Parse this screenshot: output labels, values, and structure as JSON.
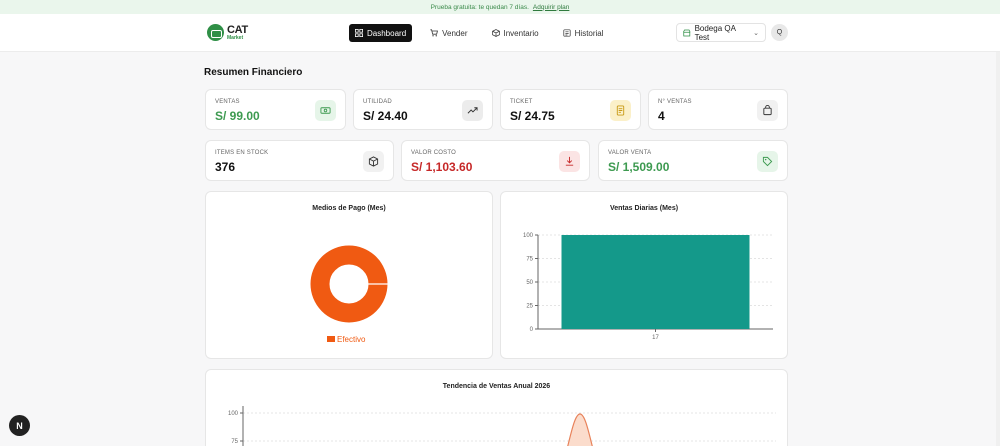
{
  "promo": {
    "text": "Prueba gratuita: te quedan 7 días.",
    "link": "Adquirir plan"
  },
  "brand": {
    "name": "CAT",
    "subtitle": "Market"
  },
  "nav": [
    {
      "label": "Dashboard",
      "icon": "grid-icon",
      "active": true
    },
    {
      "label": "Vender",
      "icon": "cart-icon",
      "active": false
    },
    {
      "label": "Inventario",
      "icon": "box-icon",
      "active": false
    },
    {
      "label": "Historial",
      "icon": "history-icon",
      "active": false
    }
  ],
  "store": {
    "name": "Bodega QA Test"
  },
  "user": {
    "initial": "Q"
  },
  "page": {
    "title": "Resumen Financiero"
  },
  "stats_row1": [
    {
      "label": "VENTAS",
      "value": "S/ 99.00",
      "color": "#3d9a50",
      "icon": "cash-icon",
      "icon_bg": "#e6f5e9"
    },
    {
      "label": "UTILIDAD",
      "value": "S/ 24.40",
      "color": "#111111",
      "icon": "trend-up-icon",
      "icon_bg": "#ececec"
    },
    {
      "label": "TICKET",
      "value": "S/ 24.75",
      "color": "#111111",
      "icon": "receipt-icon",
      "icon_bg": "#fbf0c9"
    },
    {
      "label": "N° VENTAS",
      "value": "4",
      "color": "#111111",
      "icon": "bag-icon",
      "icon_bg": "#f1f1f1"
    }
  ],
  "stats_row2": [
    {
      "label": "ITEMS EN STOCK",
      "value": "376",
      "color": "#111111",
      "icon": "cube-icon",
      "icon_bg": "#f1f1f1"
    },
    {
      "label": "VALOR COSTO",
      "value": "S/ 1,103.60",
      "color": "#c62828",
      "icon": "download-icon",
      "icon_bg": "#fbe4e4"
    },
    {
      "label": "VALOR VENTA",
      "value": "S/ 1,509.00",
      "color": "#3d9a50",
      "icon": "tag-icon",
      "icon_bg": "#e6f5e9"
    }
  ],
  "chart_data": [
    {
      "type": "pie",
      "title": "Medios de Pago (Mes)",
      "categories": [
        "Efectivo"
      ],
      "values": [
        100
      ],
      "colors": [
        "#f05a12"
      ],
      "legend": "bottom"
    },
    {
      "type": "bar",
      "title": "Ventas Diarias (Mes)",
      "categories": [
        "17"
      ],
      "values": [
        100
      ],
      "ylim": [
        0,
        100
      ],
      "yticks": [
        "0",
        "25",
        "50",
        "75",
        "100"
      ],
      "color": "#14998a",
      "grid": true
    },
    {
      "type": "line",
      "title": "Tendencia de Ventas Anual 2026",
      "yticks": [
        "75",
        "100"
      ],
      "color": "#e8825a",
      "grid": true
    }
  ]
}
